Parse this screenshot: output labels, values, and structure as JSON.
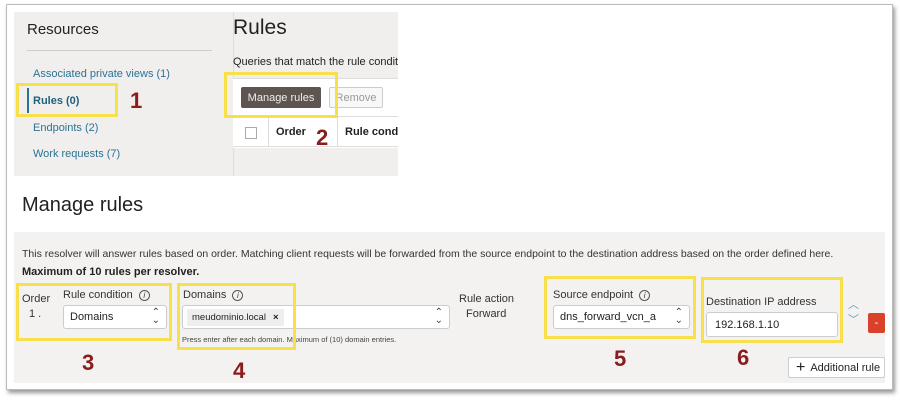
{
  "sidebar": {
    "title": "Resources",
    "items": [
      {
        "label": "Associated private views (1)"
      },
      {
        "label": "Rules (0)"
      },
      {
        "label": "Endpoints (2)"
      },
      {
        "label": "Work requests (7)"
      }
    ]
  },
  "rules_panel": {
    "title": "Rules",
    "description": "Queries that match the rule conditio",
    "manage_button": "Manage rules",
    "remove_button": "Remove",
    "columns": [
      "Order",
      "Rule condi"
    ]
  },
  "manage": {
    "title": "Manage rules",
    "description": "This resolver will answer rules based on order. Matching client requests will be forwarded from the source endpoint to the destination address based on the order defined here.",
    "max_note": "Maximum of 10 rules per resolver.",
    "order_label": "Order",
    "order_value": "1 .",
    "rule_condition_label": "Rule condition",
    "rule_condition_value": "Domains",
    "domains_label": "Domains",
    "domain_tag": "meudominio.local",
    "domain_tag_remove": "×",
    "domains_help": "Press enter after each domain. Maximum of (10) domain entries.",
    "rule_action_label": "Rule action",
    "rule_action_value": "Forward",
    "source_label": "Source endpoint",
    "source_value": "dns_forward_vcn_a",
    "dest_label": "Destination IP address",
    "dest_value": "192.168.1.10",
    "remove_rule": "-",
    "additional_rule": "Additional rule"
  },
  "annotations": [
    "1",
    "2",
    "3",
    "4",
    "5",
    "6"
  ],
  "colors": {
    "highlight": "#f7e04a",
    "annotation": "#8b1c1c",
    "link": "#2a7396",
    "danger": "#d9412b"
  }
}
